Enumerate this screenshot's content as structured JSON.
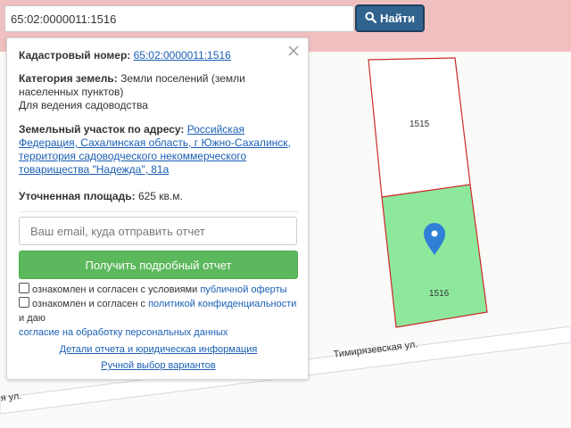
{
  "search": {
    "value": "65:02:0000011:1516",
    "button_label": "Найти",
    "button_icon": "search-icon"
  },
  "panel": {
    "cadastral": {
      "label": "Кадастровый номер:",
      "value": "65:02:0000011:1516"
    },
    "category": {
      "label": "Категория земель:",
      "value": "Земли поселений (земли населенных пунктов)",
      "use": "Для ведения садоводства"
    },
    "address": {
      "label": "Земельный участок по адресу:",
      "value": "Российская Федерация, Сахалинская область, г Южно-Сахалинск, территория садоводческого некоммерческого товарищества \"Надежда\", 81а"
    },
    "area": {
      "label": "Уточненная площадь:",
      "value": "625 кв.м."
    },
    "email_placeholder": "Ваш email, куда отправить отчет",
    "report_button": "Получить подробный отчет",
    "consent1": {
      "text": "ознакомлен и согласен с условиями",
      "link": "публичной оферты"
    },
    "consent2": {
      "text": "ознакомлен и согласен с",
      "link1": "политикой конфиденциальности",
      "mid": "и даю",
      "link2": "согласие на обработку персональных данных"
    },
    "details_link": "Детали отчета и юридическая информация",
    "manual_link": "Ручной выбор вариантов"
  },
  "map": {
    "parcels": [
      {
        "id": "1515",
        "selected": false
      },
      {
        "id": "1516",
        "selected": true
      }
    ],
    "streets": [
      "Тимирязевская ул.",
      "я ул."
    ],
    "colors": {
      "selected_fill": "#8ee89c",
      "parcel_border": "#cc2a2a",
      "marker": "#2f7fd6",
      "topbar": "#f0c0c0",
      "search_button": "#31638f",
      "report_button": "#5cb85c"
    }
  }
}
